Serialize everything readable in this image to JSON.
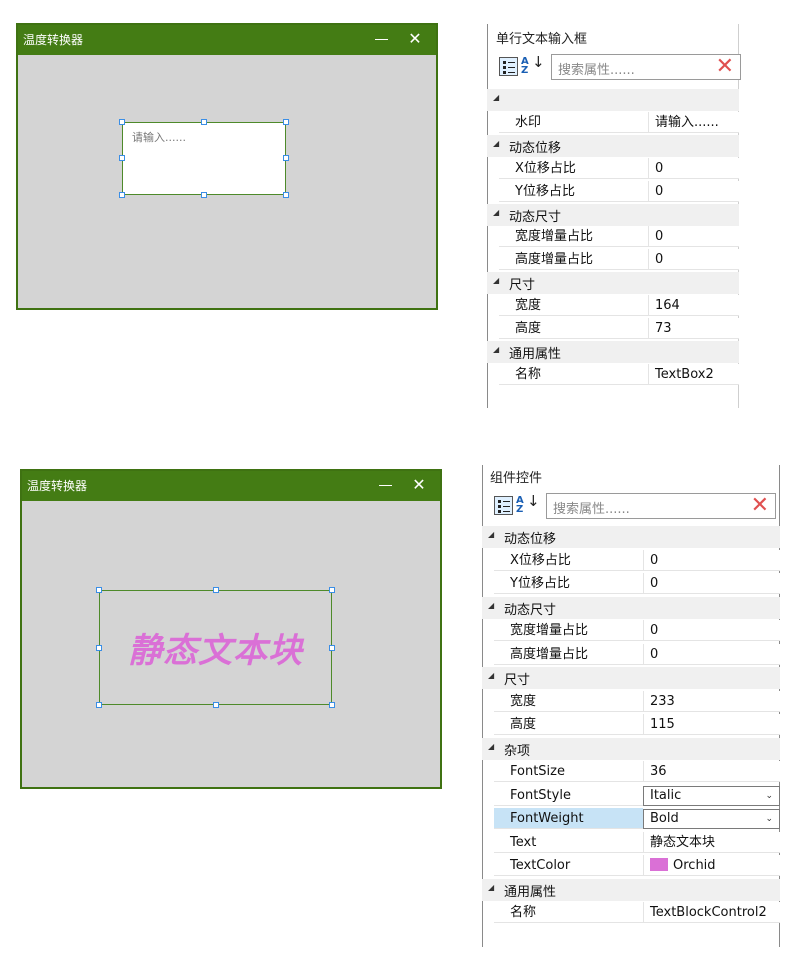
{
  "top": {
    "window": {
      "title": "温度转换器",
      "minimize_glyph": "—",
      "close_glyph": "✕"
    },
    "textbox": {
      "placeholder": "请输入......"
    },
    "properties": {
      "title": "单行文本输入框",
      "search_placeholder": "搜索属性......",
      "clear_glyph": "✕",
      "rows": [
        {
          "type": "cat",
          "label": ""
        },
        {
          "type": "prop",
          "key": "水印",
          "value": "请输入......"
        },
        {
          "type": "cat",
          "label": "动态位移"
        },
        {
          "type": "prop",
          "key": "X位移占比",
          "value": "0"
        },
        {
          "type": "prop",
          "key": "Y位移占比",
          "value": "0"
        },
        {
          "type": "cat",
          "label": "动态尺寸"
        },
        {
          "type": "prop",
          "key": "宽度增量占比",
          "value": "0"
        },
        {
          "type": "prop",
          "key": "高度增量占比",
          "value": "0"
        },
        {
          "type": "cat",
          "label": "尺寸"
        },
        {
          "type": "prop",
          "key": "宽度",
          "value": "164"
        },
        {
          "type": "prop",
          "key": "高度",
          "value": "73"
        },
        {
          "type": "cat",
          "label": "通用属性"
        },
        {
          "type": "prop",
          "key": "名称",
          "value": "TextBox2"
        }
      ]
    }
  },
  "bottom": {
    "window": {
      "title": "温度转换器",
      "minimize_glyph": "—",
      "close_glyph": "✕"
    },
    "textblock": {
      "text": "静态文本块",
      "color": "#da70d6"
    },
    "properties": {
      "title": "组件控件",
      "search_placeholder": "搜索属性......",
      "clear_glyph": "✕",
      "rows": [
        {
          "type": "cat",
          "label": "动态位移"
        },
        {
          "type": "prop",
          "key": "X位移占比",
          "value": "0"
        },
        {
          "type": "prop",
          "key": "Y位移占比",
          "value": "0"
        },
        {
          "type": "cat",
          "label": "动态尺寸"
        },
        {
          "type": "prop",
          "key": "宽度增量占比",
          "value": "0"
        },
        {
          "type": "prop",
          "key": "高度增量占比",
          "value": "0"
        },
        {
          "type": "cat",
          "label": "尺寸"
        },
        {
          "type": "prop",
          "key": "宽度",
          "value": "233"
        },
        {
          "type": "prop",
          "key": "高度",
          "value": "115"
        },
        {
          "type": "cat",
          "label": "杂项"
        },
        {
          "type": "prop",
          "key": "FontSize",
          "value": "36"
        },
        {
          "type": "prop",
          "key": "FontStyle",
          "value": "Italic",
          "combo": true
        },
        {
          "type": "prop",
          "key": "FontWeight",
          "value": "Bold",
          "combo": true,
          "selected": true
        },
        {
          "type": "prop",
          "key": "Text",
          "value": "静态文本块"
        },
        {
          "type": "prop",
          "key": "TextColor",
          "value": "Orchid",
          "swatch": "#da70d6"
        },
        {
          "type": "cat",
          "label": "通用属性"
        },
        {
          "type": "prop",
          "key": "名称",
          "value": "TextBlockControl2"
        }
      ]
    }
  },
  "icons": {
    "category_view": "categorized-icon",
    "alphabetical_view": "sort-az-icon",
    "collapse": "triangle-collapse-icon"
  }
}
